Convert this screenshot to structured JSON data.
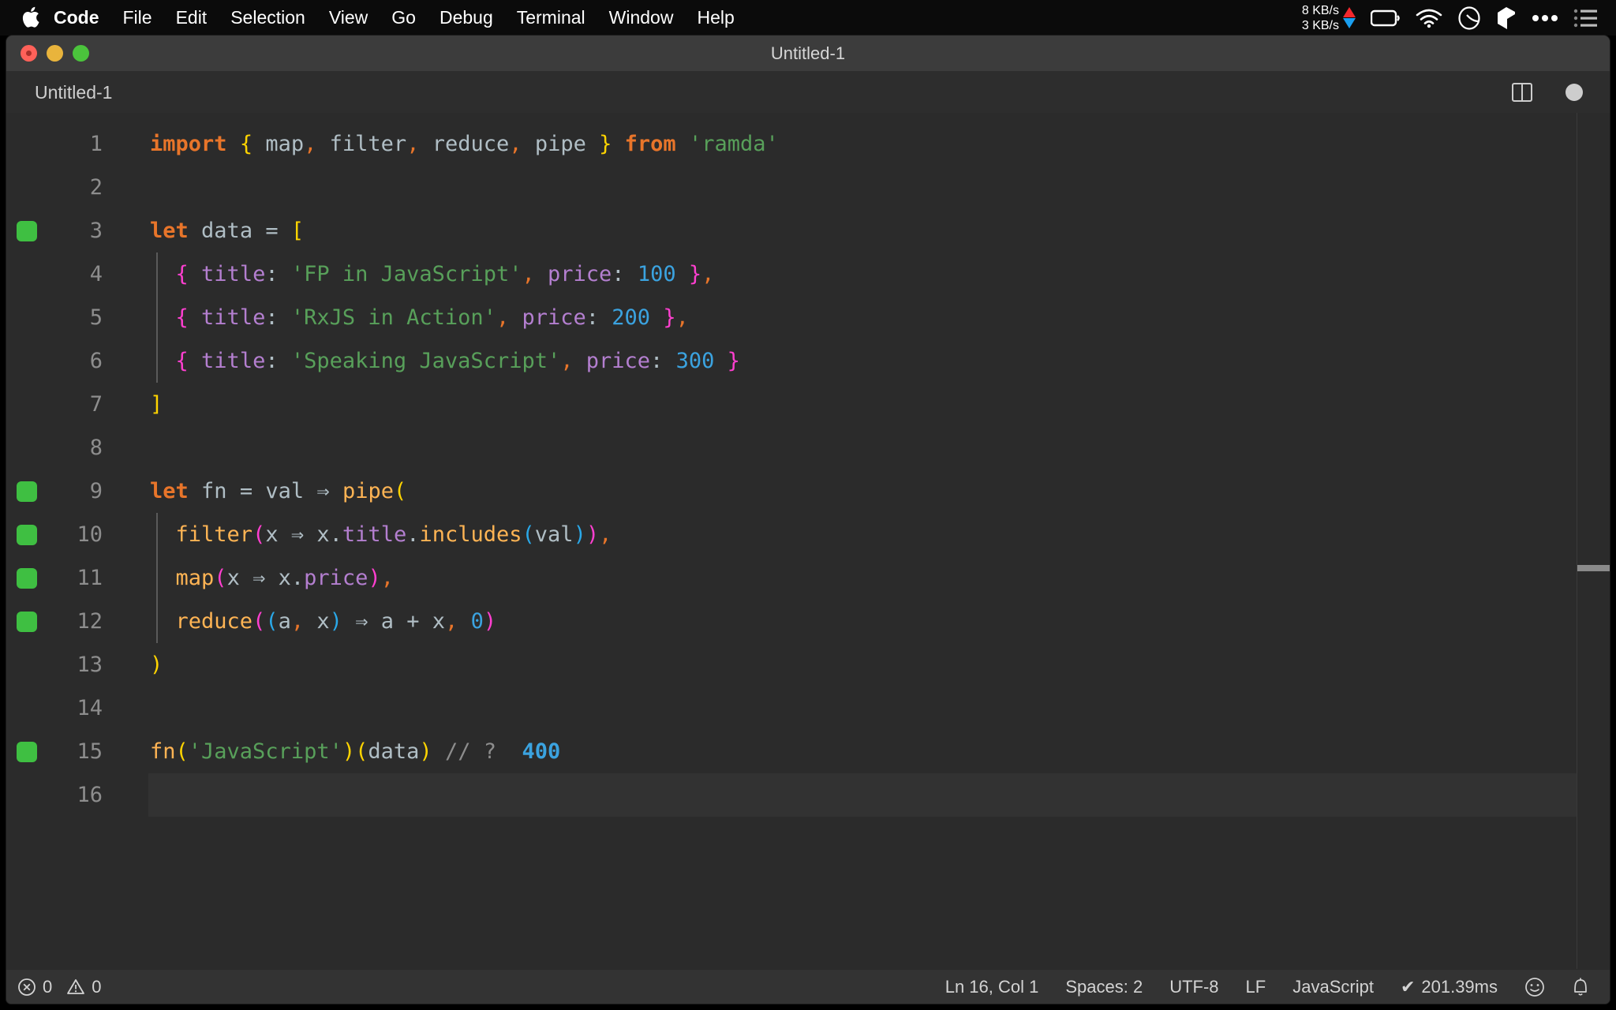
{
  "menubar": {
    "apple_icon": "apple-logo",
    "items": [
      {
        "label": "Code",
        "bold": true
      },
      {
        "label": "File",
        "bold": false
      },
      {
        "label": "Edit",
        "bold": false
      },
      {
        "label": "Selection",
        "bold": false
      },
      {
        "label": "View",
        "bold": false
      },
      {
        "label": "Go",
        "bold": false
      },
      {
        "label": "Debug",
        "bold": false
      },
      {
        "label": "Terminal",
        "bold": false
      },
      {
        "label": "Window",
        "bold": false
      },
      {
        "label": "Help",
        "bold": false
      }
    ],
    "network": {
      "upload": "8 KB/s",
      "download": "3 KB/s",
      "upload_color": "#f3282d",
      "download_color": "#1a9ff0"
    },
    "status_icons": [
      "battery-icon",
      "wifi-icon",
      "clock-icon",
      "cube-icon",
      "ellipsis-icon",
      "list-icon"
    ]
  },
  "window": {
    "title": "Untitled-1",
    "traffic_lights": [
      "close-button",
      "minimize-button",
      "maximize-button"
    ]
  },
  "tabbar": {
    "tabs": [
      {
        "label": "Untitled-1",
        "active": true
      }
    ],
    "actions": [
      "split-editor-icon",
      "unsaved-indicator"
    ]
  },
  "editor": {
    "current_line": 16,
    "lines": [
      {
        "no": "1",
        "marker": false,
        "indent_guide": false,
        "tokens": [
          {
            "t": "import",
            "c": "k"
          },
          {
            "t": " ",
            "c": "op"
          },
          {
            "t": "{",
            "c": "brc-y"
          },
          {
            "t": " ",
            "c": "op"
          },
          {
            "t": "map",
            "c": "ident"
          },
          {
            "t": ",",
            "c": "comma"
          },
          {
            "t": " ",
            "c": "op"
          },
          {
            "t": "filter",
            "c": "ident"
          },
          {
            "t": ",",
            "c": "comma"
          },
          {
            "t": " ",
            "c": "op"
          },
          {
            "t": "reduce",
            "c": "ident"
          },
          {
            "t": ",",
            "c": "comma"
          },
          {
            "t": " ",
            "c": "op"
          },
          {
            "t": "pipe",
            "c": "ident"
          },
          {
            "t": " ",
            "c": "op"
          },
          {
            "t": "}",
            "c": "brc-y"
          },
          {
            "t": " ",
            "c": "op"
          },
          {
            "t": "from",
            "c": "k"
          },
          {
            "t": " ",
            "c": "op"
          },
          {
            "t": "'ramda'",
            "c": "str"
          }
        ]
      },
      {
        "no": "2",
        "marker": false,
        "indent_guide": false,
        "tokens": []
      },
      {
        "no": "3",
        "marker": true,
        "indent_guide": false,
        "tokens": [
          {
            "t": "let",
            "c": "k"
          },
          {
            "t": " ",
            "c": "op"
          },
          {
            "t": "data",
            "c": "ident"
          },
          {
            "t": " ",
            "c": "op"
          },
          {
            "t": "=",
            "c": "op"
          },
          {
            "t": " ",
            "c": "op"
          },
          {
            "t": "[",
            "c": "brc-y"
          }
        ]
      },
      {
        "no": "4",
        "marker": false,
        "indent_guide": true,
        "tokens": [
          {
            "t": "  ",
            "c": "op"
          },
          {
            "t": "{",
            "c": "brc-p"
          },
          {
            "t": " ",
            "c": "op"
          },
          {
            "t": "title",
            "c": "prop"
          },
          {
            "t": ":",
            "c": "colon"
          },
          {
            "t": " ",
            "c": "op"
          },
          {
            "t": "'FP in JavaScript'",
            "c": "str"
          },
          {
            "t": ",",
            "c": "comma"
          },
          {
            "t": " ",
            "c": "op"
          },
          {
            "t": "price",
            "c": "prop"
          },
          {
            "t": ":",
            "c": "colon"
          },
          {
            "t": " ",
            "c": "op"
          },
          {
            "t": "100",
            "c": "num"
          },
          {
            "t": " ",
            "c": "op"
          },
          {
            "t": "}",
            "c": "brc-p"
          },
          {
            "t": ",",
            "c": "comma"
          }
        ]
      },
      {
        "no": "5",
        "marker": false,
        "indent_guide": true,
        "tokens": [
          {
            "t": "  ",
            "c": "op"
          },
          {
            "t": "{",
            "c": "brc-p"
          },
          {
            "t": " ",
            "c": "op"
          },
          {
            "t": "title",
            "c": "prop"
          },
          {
            "t": ":",
            "c": "colon"
          },
          {
            "t": " ",
            "c": "op"
          },
          {
            "t": "'RxJS in Action'",
            "c": "str"
          },
          {
            "t": ",",
            "c": "comma"
          },
          {
            "t": " ",
            "c": "op"
          },
          {
            "t": "price",
            "c": "prop"
          },
          {
            "t": ":",
            "c": "colon"
          },
          {
            "t": " ",
            "c": "op"
          },
          {
            "t": "200",
            "c": "num"
          },
          {
            "t": " ",
            "c": "op"
          },
          {
            "t": "}",
            "c": "brc-p"
          },
          {
            "t": ",",
            "c": "comma"
          }
        ]
      },
      {
        "no": "6",
        "marker": false,
        "indent_guide": true,
        "tokens": [
          {
            "t": "  ",
            "c": "op"
          },
          {
            "t": "{",
            "c": "brc-p"
          },
          {
            "t": " ",
            "c": "op"
          },
          {
            "t": "title",
            "c": "prop"
          },
          {
            "t": ":",
            "c": "colon"
          },
          {
            "t": " ",
            "c": "op"
          },
          {
            "t": "'Speaking JavaScript'",
            "c": "str"
          },
          {
            "t": ",",
            "c": "comma"
          },
          {
            "t": " ",
            "c": "op"
          },
          {
            "t": "price",
            "c": "prop"
          },
          {
            "t": ":",
            "c": "colon"
          },
          {
            "t": " ",
            "c": "op"
          },
          {
            "t": "300",
            "c": "num"
          },
          {
            "t": " ",
            "c": "op"
          },
          {
            "t": "}",
            "c": "brc-p"
          }
        ]
      },
      {
        "no": "7",
        "marker": false,
        "indent_guide": false,
        "tokens": [
          {
            "t": "]",
            "c": "brc-y"
          }
        ]
      },
      {
        "no": "8",
        "marker": false,
        "indent_guide": false,
        "tokens": []
      },
      {
        "no": "9",
        "marker": true,
        "indent_guide": false,
        "tokens": [
          {
            "t": "let",
            "c": "k"
          },
          {
            "t": " ",
            "c": "op"
          },
          {
            "t": "fn",
            "c": "ident"
          },
          {
            "t": " ",
            "c": "op"
          },
          {
            "t": "=",
            "c": "op"
          },
          {
            "t": " ",
            "c": "op"
          },
          {
            "t": "val",
            "c": "ident"
          },
          {
            "t": " ",
            "c": "op"
          },
          {
            "t": "⇒",
            "c": "op"
          },
          {
            "t": " ",
            "c": "op"
          },
          {
            "t": "pipe",
            "c": "fn"
          },
          {
            "t": "(",
            "c": "brc-y"
          }
        ]
      },
      {
        "no": "10",
        "marker": true,
        "indent_guide": true,
        "tokens": [
          {
            "t": "  ",
            "c": "op"
          },
          {
            "t": "filter",
            "c": "fn"
          },
          {
            "t": "(",
            "c": "brc-p"
          },
          {
            "t": "x",
            "c": "ident"
          },
          {
            "t": " ",
            "c": "op"
          },
          {
            "t": "⇒",
            "c": "op"
          },
          {
            "t": " ",
            "c": "op"
          },
          {
            "t": "x",
            "c": "ident"
          },
          {
            "t": ".",
            "c": "ident"
          },
          {
            "t": "title",
            "c": "prop"
          },
          {
            "t": ".",
            "c": "ident"
          },
          {
            "t": "includes",
            "c": "fn"
          },
          {
            "t": "(",
            "c": "brc-b"
          },
          {
            "t": "val",
            "c": "ident"
          },
          {
            "t": ")",
            "c": "brc-b"
          },
          {
            "t": ")",
            "c": "brc-p"
          },
          {
            "t": ",",
            "c": "comma"
          }
        ]
      },
      {
        "no": "11",
        "marker": true,
        "indent_guide": true,
        "tokens": [
          {
            "t": "  ",
            "c": "op"
          },
          {
            "t": "map",
            "c": "fn"
          },
          {
            "t": "(",
            "c": "brc-p"
          },
          {
            "t": "x",
            "c": "ident"
          },
          {
            "t": " ",
            "c": "op"
          },
          {
            "t": "⇒",
            "c": "op"
          },
          {
            "t": " ",
            "c": "op"
          },
          {
            "t": "x",
            "c": "ident"
          },
          {
            "t": ".",
            "c": "ident"
          },
          {
            "t": "price",
            "c": "prop"
          },
          {
            "t": ")",
            "c": "brc-p"
          },
          {
            "t": ",",
            "c": "comma"
          }
        ]
      },
      {
        "no": "12",
        "marker": true,
        "indent_guide": true,
        "tokens": [
          {
            "t": "  ",
            "c": "op"
          },
          {
            "t": "reduce",
            "c": "fn"
          },
          {
            "t": "(",
            "c": "brc-p"
          },
          {
            "t": "(",
            "c": "brc-b"
          },
          {
            "t": "a",
            "c": "ident"
          },
          {
            "t": ",",
            "c": "comma"
          },
          {
            "t": " ",
            "c": "op"
          },
          {
            "t": "x",
            "c": "ident"
          },
          {
            "t": ")",
            "c": "brc-b"
          },
          {
            "t": " ",
            "c": "op"
          },
          {
            "t": "⇒",
            "c": "op"
          },
          {
            "t": " ",
            "c": "op"
          },
          {
            "t": "a",
            "c": "ident"
          },
          {
            "t": " ",
            "c": "op"
          },
          {
            "t": "+",
            "c": "op"
          },
          {
            "t": " ",
            "c": "op"
          },
          {
            "t": "x",
            "c": "ident"
          },
          {
            "t": ",",
            "c": "comma"
          },
          {
            "t": " ",
            "c": "op"
          },
          {
            "t": "0",
            "c": "num"
          },
          {
            "t": ")",
            "c": "brc-p"
          }
        ]
      },
      {
        "no": "13",
        "marker": false,
        "indent_guide": false,
        "tokens": [
          {
            "t": ")",
            "c": "brc-y"
          }
        ]
      },
      {
        "no": "14",
        "marker": false,
        "indent_guide": false,
        "tokens": []
      },
      {
        "no": "15",
        "marker": true,
        "indent_guide": false,
        "tokens": [
          {
            "t": "fn",
            "c": "fn"
          },
          {
            "t": "(",
            "c": "brc-y"
          },
          {
            "t": "'JavaScript'",
            "c": "str"
          },
          {
            "t": ")",
            "c": "brc-y"
          },
          {
            "t": "(",
            "c": "brc-y"
          },
          {
            "t": "data",
            "c": "ident"
          },
          {
            "t": ")",
            "c": "brc-y"
          },
          {
            "t": " ",
            "c": "op"
          },
          {
            "t": "// ?",
            "c": "cmt"
          },
          {
            "t": "  ",
            "c": "op"
          },
          {
            "t": "400",
            "c": "res"
          }
        ]
      },
      {
        "no": "16",
        "marker": false,
        "indent_guide": false,
        "tokens": []
      }
    ],
    "gutter_marker_color": "#3fbf42"
  },
  "statusbar": {
    "errors": "0",
    "warnings": "0",
    "cursor": "Ln 16, Col 1",
    "indent": "Spaces: 2",
    "encoding": "UTF-8",
    "eol": "LF",
    "language": "JavaScript",
    "runtime": "201.39ms",
    "runtime_check": "✔",
    "feedback_icon": "smiley-icon",
    "bell_icon": "bell-icon"
  }
}
